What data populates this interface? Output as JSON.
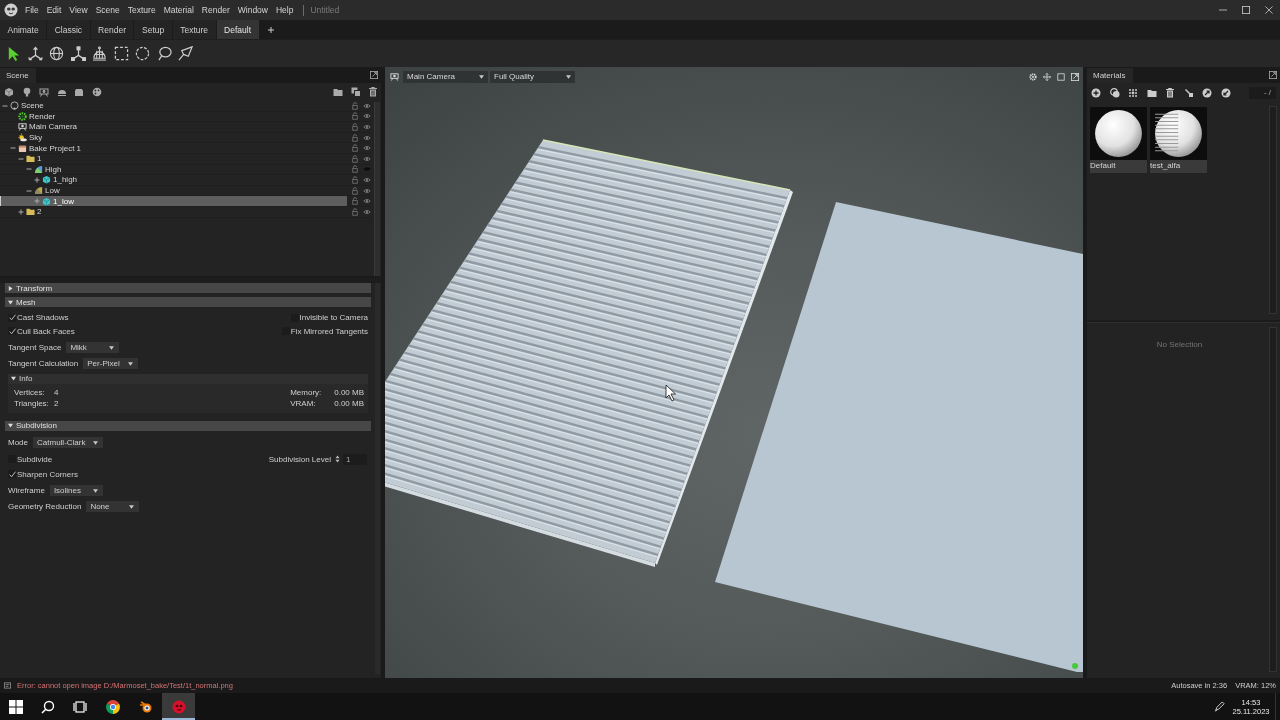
{
  "menu_bar": {
    "items": [
      "File",
      "Edit",
      "View",
      "Scene",
      "Texture",
      "Material",
      "Render",
      "Window",
      "Help"
    ],
    "document": "Untitled"
  },
  "layout_tabs": [
    {
      "label": "Animate",
      "selected": false
    },
    {
      "label": "Classic",
      "selected": false
    },
    {
      "label": "Render",
      "selected": false
    },
    {
      "label": "Setup",
      "selected": false
    },
    {
      "label": "Texture",
      "selected": false
    },
    {
      "label": "Default",
      "selected": true
    }
  ],
  "tools": [
    {
      "kind": "select",
      "selected": true
    },
    {
      "kind": "move",
      "selected": false
    },
    {
      "kind": "rotate",
      "selected": false
    },
    {
      "kind": "scale",
      "selected": false
    },
    {
      "kind": "light",
      "selected": false
    },
    {
      "kind": "box_select",
      "selected": false
    },
    {
      "kind": "circle_select",
      "selected": false
    },
    {
      "kind": "lasso",
      "selected": false
    },
    {
      "kind": "polygon_lasso",
      "selected": false
    }
  ],
  "scene_panel": {
    "title": "Scene",
    "tree": [
      {
        "label": "Scene",
        "kind": "scene",
        "expanded": true,
        "selected": false,
        "visible": true,
        "children": [
          {
            "label": "Render",
            "kind": "render",
            "selected": false,
            "visible": true
          },
          {
            "label": "Main Camera",
            "kind": "camera",
            "selected": false,
            "visible": true
          },
          {
            "label": "Sky",
            "kind": "sky",
            "selected": false,
            "visible": true
          },
          {
            "label": "Bake Project 1",
            "kind": "project",
            "expanded": true,
            "selected": false,
            "visible": true,
            "children": [
              {
                "label": "1",
                "kind": "folder",
                "expanded": true,
                "selected": false,
                "visible": true,
                "children": [
                  {
                    "label": "High",
                    "kind": "high_group",
                    "expanded": true,
                    "selected": false,
                    "visible": false,
                    "children": [
                      {
                        "label": "1_high",
                        "kind": "mesh",
                        "expanded": false,
                        "selected": false,
                        "visible": true
                      }
                    ]
                  },
                  {
                    "label": "Low",
                    "kind": "low_group",
                    "expanded": true,
                    "selected": false,
                    "visible": true,
                    "children": [
                      {
                        "label": "1_low",
                        "kind": "mesh",
                        "expanded": false,
                        "selected": true,
                        "visible": true
                      }
                    ]
                  }
                ]
              },
              {
                "label": "2",
                "kind": "folder",
                "expanded": false,
                "selected": false,
                "visible": true
              }
            ]
          }
        ]
      }
    ]
  },
  "properties": {
    "sections": [
      {
        "title": "Transform",
        "expanded": false
      },
      {
        "title": "Mesh",
        "expanded": true,
        "rows": [
          {
            "kind": "pair",
            "left": {
              "kind": "checkbox",
              "label": "Cast Shadows",
              "checked": true
            },
            "right": {
              "kind": "checkbox",
              "label": "Invisible to Camera",
              "checked": false
            }
          },
          {
            "kind": "pair",
            "left": {
              "kind": "checkbox",
              "label": "Cull Back Faces",
              "checked": true
            },
            "right": {
              "kind": "checkbox",
              "label": "Fix Mirrored Tangents",
              "checked": false
            }
          },
          {
            "kind": "dropdown",
            "label": "Tangent Space",
            "value": "Mikk"
          },
          {
            "kind": "dropdown",
            "label": "Tangent Calculation",
            "value": "Per-Pixel"
          },
          {
            "kind": "group",
            "title": "Info",
            "expanded": true,
            "left": [
              {
                "label": "Vertices:",
                "value": "4"
              },
              {
                "label": "Triangles:",
                "value": "2"
              }
            ],
            "right": [
              {
                "label": "Memory:",
                "value": "0.00 MB"
              },
              {
                "label": "VRAM:",
                "value": "0.00 MB"
              }
            ]
          }
        ]
      },
      {
        "title": "Subdivision",
        "expanded": true,
        "rows": [
          {
            "kind": "dropdown",
            "label": "Mode",
            "value": "Catmull-Clark"
          },
          {
            "kind": "pair",
            "left": {
              "kind": "checkbox",
              "label": "Subdivide",
              "checked": false
            },
            "right": {
              "kind": "spinner",
              "label": "Subdivision Level",
              "value": "1"
            }
          },
          {
            "kind": "pair",
            "left": {
              "kind": "checkbox",
              "label": "Sharpen Corners",
              "checked": true
            }
          },
          {
            "kind": "dropdown",
            "label": "Wireframe",
            "value": "Isolines"
          },
          {
            "kind": "dropdown",
            "label": "Geometry Reduction",
            "value": "None"
          }
        ]
      }
    ]
  },
  "viewport": {
    "camera": "Main Camera",
    "quality": "Full Quality"
  },
  "materials_panel": {
    "title": "Materials",
    "page": "- /",
    "items": [
      {
        "name": "Default",
        "kind": "plain",
        "selected": false
      },
      {
        "name": "test_alfa",
        "kind": "striped",
        "selected": false
      }
    ],
    "empty_message": "No Selection"
  },
  "status_bar": {
    "message": "Error: cannot open image D:/Marmoset_bake/Test/1t_normal.png",
    "kind": "error",
    "autosave": "Autosave in 2:36",
    "vram": "VRAM: 12%"
  },
  "taskbar": {
    "apps": [
      {
        "kind": "browser",
        "selected": false
      },
      {
        "kind": "modeler",
        "selected": false
      },
      {
        "kind": "baker",
        "selected": true
      }
    ],
    "time": "14:53",
    "date": "25.11.2023"
  }
}
